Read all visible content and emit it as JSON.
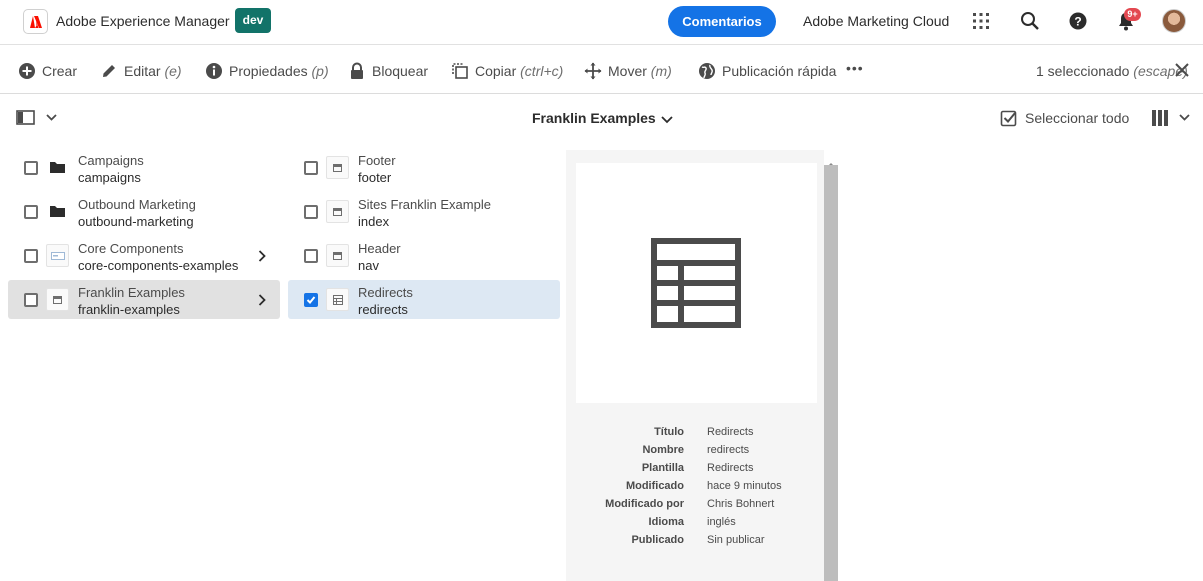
{
  "header": {
    "app_title": "Adobe Experience Manager",
    "env_badge": "dev",
    "feedback_label": "Comentarios",
    "marketing_cloud_label": "Adobe Marketing Cloud",
    "notifications_count": "9+",
    "accent_color": "#1473e6",
    "env_color": "#127369"
  },
  "actionbar": {
    "create": "Crear",
    "edit": "Editar",
    "edit_hint": "(e)",
    "properties": "Propiedades",
    "properties_hint": "(p)",
    "lock": "Bloquear",
    "copy": "Copiar",
    "copy_hint": "(ctrl+c)",
    "move": "Mover",
    "move_hint": "(m)",
    "quick_publish": "Publicación rápida",
    "more": "•••",
    "selected_count": "1 seleccionado",
    "selected_hint": "(escape)"
  },
  "subbar": {
    "folder_title": "Franklin Examples",
    "select_all": "Seleccionar todo"
  },
  "column1": [
    {
      "title": "Campaigns",
      "name": "campaigns",
      "icon": "folder-icon",
      "has_children": false
    },
    {
      "title": "Outbound Marketing",
      "name": "outbound-marketing",
      "icon": "folder-icon",
      "has_children": false
    },
    {
      "title": "Core Components",
      "name": "core-components-examples",
      "icon": "page-thumb-icon",
      "has_children": true
    },
    {
      "title": "Franklin Examples",
      "name": "franklin-examples",
      "icon": "page-icon",
      "has_children": true
    }
  ],
  "column2": [
    {
      "title": "Footer",
      "name": "footer",
      "icon": "page-icon"
    },
    {
      "title": "Sites Franklin Example",
      "name": "index",
      "icon": "page-icon"
    },
    {
      "title": "Header",
      "name": "nav",
      "icon": "page-icon"
    },
    {
      "title": "Redirects",
      "name": "redirects",
      "icon": "table-icon"
    }
  ],
  "preview": {
    "icon": "table-icon",
    "meta": [
      {
        "key": "Título",
        "value": "Redirects"
      },
      {
        "key": "Nombre",
        "value": "redirects"
      },
      {
        "key": "Plantilla",
        "value": "Redirects"
      },
      {
        "key": "Modificado",
        "value": "hace 9 minutos"
      },
      {
        "key": "Modificado por",
        "value": "Chris Bohnert"
      },
      {
        "key": "Idioma",
        "value": "inglés"
      },
      {
        "key": "Publicado",
        "value": "Sin publicar"
      }
    ]
  }
}
